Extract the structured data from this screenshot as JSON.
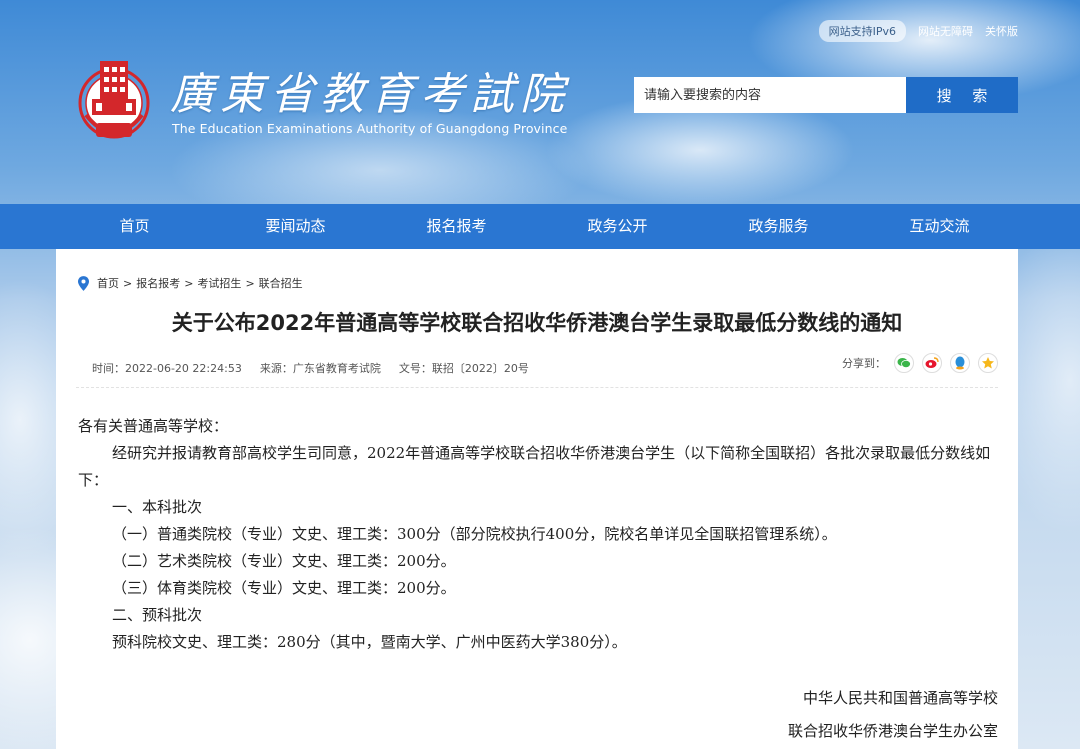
{
  "header": {
    "ipv6_badge": "网站支持IPv6",
    "accessibility_link": "网站无障碍",
    "care_link": "关怀版",
    "logo_title": "廣東省教育考試院",
    "logo_subtitle": "The Education Examinations Authority of Guangdong Province",
    "search_placeholder": "请输入要搜索的内容",
    "search_button": "搜 索"
  },
  "nav": {
    "items": [
      "首页",
      "要闻动态",
      "报名报考",
      "政务公开",
      "政务服务",
      "互动交流"
    ]
  },
  "breadcrumb": [
    "首页",
    "报名报考",
    "考试招生",
    "联合招生"
  ],
  "article": {
    "title": "关于公布2022年普通高等学校联合招收华侨港澳台学生录取最低分数线的通知",
    "time": "时间：2022-06-20 22:24:53",
    "source": "来源：广东省教育考试院",
    "doc_no": "文号：联招〔2022〕20号",
    "share_label": "分享到：",
    "share_icons": [
      "wechat-icon",
      "weibo-icon",
      "qq-icon",
      "qzone-icon"
    ],
    "paragraphs": [
      "各有关普通高等学校：",
      "经研究并报请教育部高校学生司同意，2022年普通高等学校联合招收华侨港澳台学生（以下简称全国联招）各批次录取最低分数线如下：",
      "一、本科批次",
      "（一）普通类院校（专业）文史、理工类：300分（部分院校执行400分，院校名单详见全国联招管理系统）。",
      "（二）艺术类院校（专业）文史、理工类：200分。",
      "（三）体育类院校（专业）文史、理工类：200分。",
      "二、预科批次",
      "预科院校文史、理工类：280分（其中，暨南大学、广州中医药大学380分）。"
    ],
    "signature_line1": "中华人民共和国普通高等学校",
    "signature_line2": "联合招收华侨港澳台学生办公室"
  },
  "colors": {
    "nav_bg": "#2a76d2",
    "search_button_bg": "#1f6cc7",
    "logo_red": "#d3272b"
  }
}
